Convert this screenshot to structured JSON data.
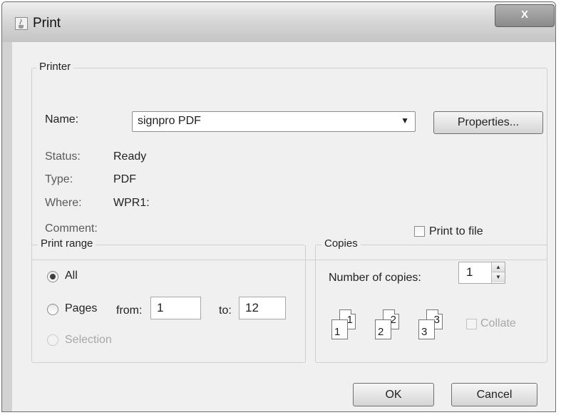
{
  "window": {
    "title": "Print",
    "close_label": "X"
  },
  "printer": {
    "legend": "Printer",
    "name_label": "Name:",
    "name_value": "signpro PDF",
    "properties_label": "Properties...",
    "status_label": "Status:",
    "status_value": "Ready",
    "type_label": "Type:",
    "type_value": "PDF",
    "where_label": "Where:",
    "where_value": "WPR1:",
    "comment_label": "Comment:",
    "print_to_file_label": "Print to file",
    "print_to_file_checked": false
  },
  "print_range": {
    "legend": "Print range",
    "all_label": "All",
    "pages_label": "Pages",
    "from_label": "from:",
    "from_value": "1",
    "to_label": "to:",
    "to_value": "12",
    "selection_label": "Selection",
    "selected": "All"
  },
  "copies": {
    "legend": "Copies",
    "number_label": "Number of copies:",
    "number_value": "1",
    "collate_label": "Collate",
    "collate_checked": false,
    "page_icons": [
      {
        "front": "1",
        "back": "1"
      },
      {
        "front": "2",
        "back": "2"
      },
      {
        "front": "3",
        "back": "3"
      }
    ]
  },
  "buttons": {
    "ok": "OK",
    "cancel": "Cancel"
  },
  "icons": {
    "title": "java-cup-icon",
    "dropdown": "chevron-down-icon",
    "spin_up": "spin-up-icon",
    "spin_down": "spin-down-icon"
  }
}
